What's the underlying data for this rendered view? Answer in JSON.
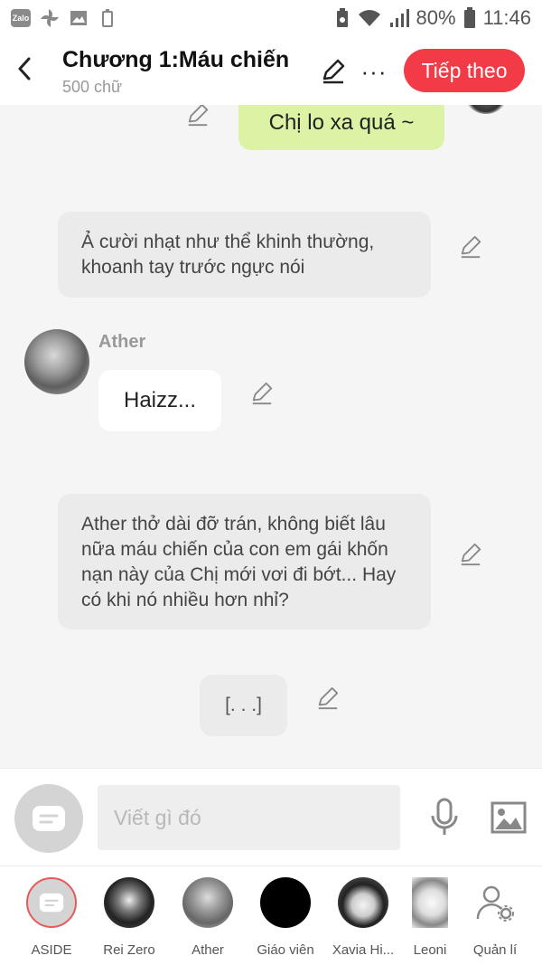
{
  "status_bar": {
    "battery_percent": "80%",
    "time": "11:46",
    "left_icons": [
      "zalo-icon",
      "pinwheel-icon",
      "gallery-icon",
      "battery-saver-icon"
    ],
    "right_icons": [
      "recycle-icon",
      "wifi-icon",
      "signal-icon",
      "battery-icon"
    ]
  },
  "header": {
    "title": "Chương 1:Máu chiến",
    "subtitle": "500 chữ",
    "next_label": "Tiếp theo",
    "more_label": "···",
    "accent_color": "#f23b46"
  },
  "messages": [
    {
      "type": "outgoing",
      "text": "Chị lo xa quá ~",
      "color": "#dcf3a6"
    },
    {
      "type": "narration",
      "text": "Ả cười nhạt như thể khinh thường, khoanh tay trước ngực nói"
    },
    {
      "type": "incoming",
      "sender": "Ather",
      "text": "Haizz..."
    },
    {
      "type": "narration",
      "text": "Ather thở dài đỡ trán, không biết lâu nữa máu chiến của con em gái khốn nạn này của Chị mới vơi đi bớt... Hay có khi nó nhiều hơn nhỉ?"
    },
    {
      "type": "narration",
      "text": "[. . .]"
    }
  ],
  "composer": {
    "placeholder": "Viết gì đó"
  },
  "characters": [
    {
      "label": "ASIDE"
    },
    {
      "label": "Rei Zero"
    },
    {
      "label": "Ather"
    },
    {
      "label": "Giáo viên"
    },
    {
      "label": "Xavia Hi..."
    },
    {
      "label": "Leoni"
    },
    {
      "label": "Quản lí"
    }
  ]
}
